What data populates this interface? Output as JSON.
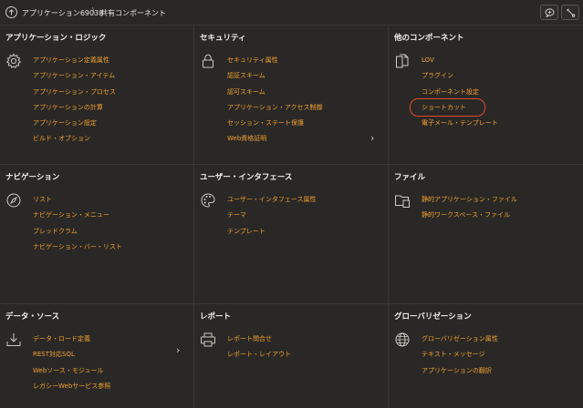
{
  "breadcrumb": {
    "app": "アプリケーション69038",
    "separator": "\\",
    "current": "共有コンポーネント"
  },
  "sections": [
    {
      "title": "アプリケーション・ロジック",
      "icon": "gear-icon",
      "links": [
        "アプリケーション定義属性",
        "アプリケーション・アイテム",
        "アプリケーション・プロセス",
        "アプリケーションの計算",
        "アプリケーション設定",
        "ビルド・オプション"
      ]
    },
    {
      "title": "セキュリティ",
      "icon": "lock-icon",
      "links": [
        "セキュリティ属性",
        "認証スキーム",
        "認可スキーム",
        "アプリケーション・アクセス制御",
        "セッション・ステート保護",
        "Web資格証明"
      ]
    },
    {
      "title": "他のコンポーネント",
      "icon": "documents-icon",
      "links": [
        "LOV",
        "プラグイン",
        "コンポーネント設定",
        "ショートカット",
        "電子メール・テンプレート"
      ]
    },
    {
      "title": "ナビゲーション",
      "icon": "compass-icon",
      "links": [
        "リスト",
        "ナビゲーション・メニュー",
        "ブレッドクラム",
        "ナビゲーション・バー・リスト"
      ]
    },
    {
      "title": "ユーザー・インタフェース",
      "icon": "palette-icon",
      "links": [
        "ユーザー・インタフェース属性",
        "テーマ",
        "テンプレート"
      ]
    },
    {
      "title": "ファイル",
      "icon": "folder-icon",
      "links": [
        "静的アプリケーション・ファイル",
        "静的ワークスペース・ファイル"
      ]
    },
    {
      "title": "データ・ソース",
      "icon": "download-icon",
      "links": [
        "データ・ロード定義",
        "REST対応SQL",
        "Webソース・モジュール",
        "レガシーWebサービス参照"
      ]
    },
    {
      "title": "レポート",
      "icon": "printer-icon",
      "links": [
        "レポート問合せ",
        "レポート・レイアウト"
      ]
    },
    {
      "title": "グローバリゼーション",
      "icon": "globe-icon",
      "links": [
        "グローバリゼーション属性",
        "テキスト・メッセージ",
        "アプリケーションの翻訳"
      ]
    }
  ]
}
